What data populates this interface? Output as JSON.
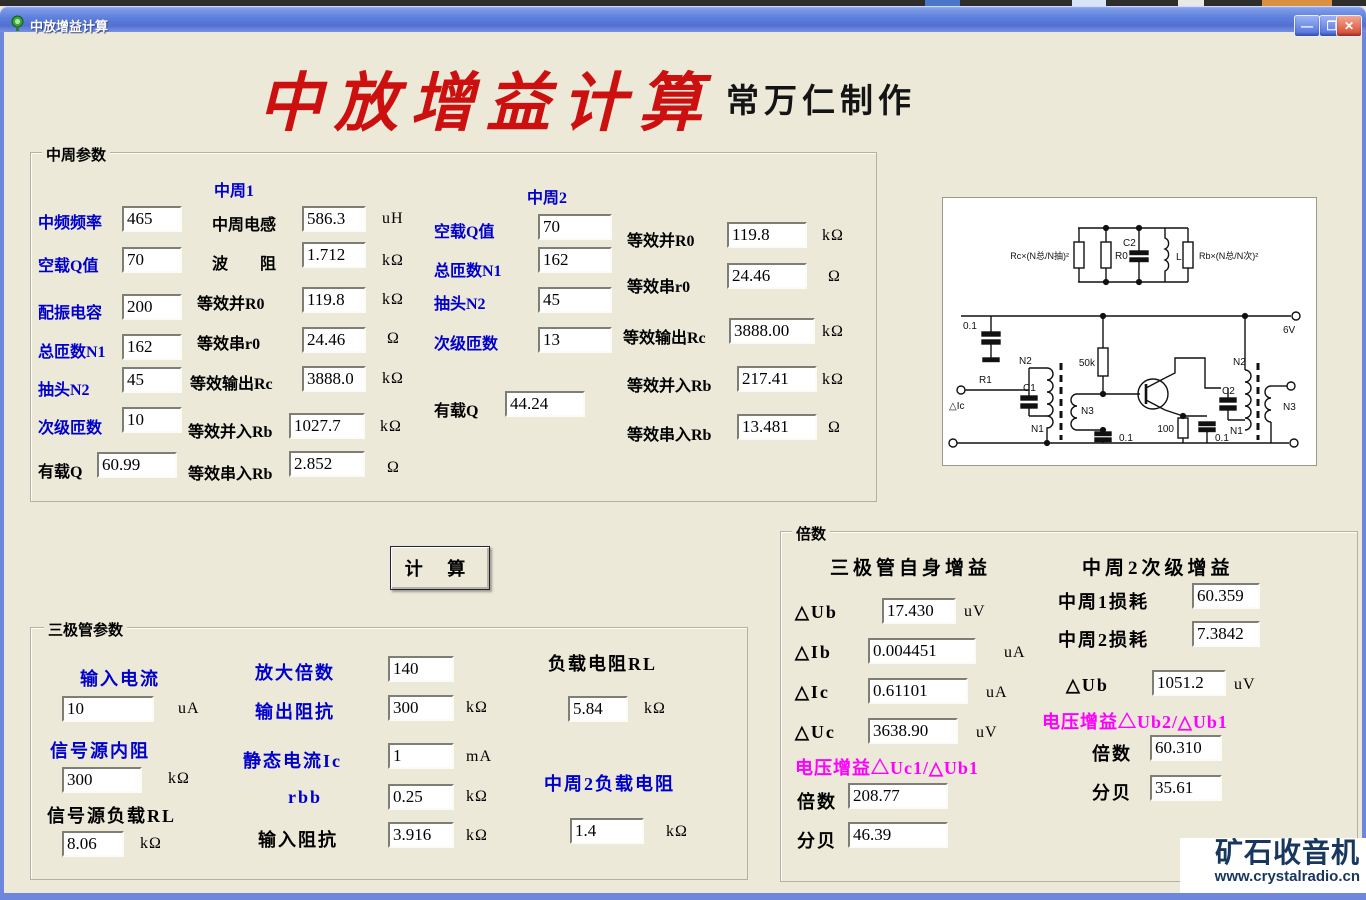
{
  "window": {
    "title": "中放增益计算",
    "min_glyph": "—",
    "max_glyph": "❐",
    "close_glyph": "✕"
  },
  "header": {
    "title": "中放增益计算",
    "author": "常万仁制作"
  },
  "ifp": {
    "group": "中周参数",
    "left": [
      {
        "label": "中频频率",
        "value": "465"
      },
      {
        "label": "空载Q值",
        "value": "70"
      },
      {
        "label": "配振电容",
        "value": "200"
      },
      {
        "label": "总匝数N1",
        "value": "162"
      },
      {
        "label": "抽头N2",
        "value": "45"
      },
      {
        "label": "次级匝数",
        "value": "10"
      },
      {
        "label": "有载Q",
        "value": "60.99"
      }
    ],
    "z1": {
      "header": "中周1",
      "rows": [
        {
          "label": "中周电感",
          "value": "586.3",
          "unit": "uH"
        },
        {
          "label": "波　　阻",
          "value": "1.712",
          "unit": "kΩ"
        },
        {
          "label": "等效并R0",
          "value": "119.8",
          "unit": "kΩ"
        },
        {
          "label": "等效串r0",
          "value": "24.46",
          "unit": "Ω"
        },
        {
          "label": "等效输出Rc",
          "value": "3888.0",
          "unit": "kΩ"
        },
        {
          "label": "等效并入Rb",
          "value": "1027.7",
          "unit": "kΩ"
        },
        {
          "label": "等效串入Rb",
          "value": "2.852",
          "unit": "Ω"
        }
      ]
    },
    "z2": {
      "header": "中周2",
      "rows": [
        {
          "label": "空载Q值",
          "value": "70"
        },
        {
          "label": "总匝数N1",
          "value": "162"
        },
        {
          "label": "抽头N2",
          "value": "45"
        },
        {
          "label": "次级匝数",
          "value": "13"
        },
        {
          "label": "有载Q",
          "value": "44.24"
        }
      ]
    },
    "right": [
      {
        "label": "等效并R0",
        "value": "119.8",
        "unit": "kΩ"
      },
      {
        "label": "等效串r0",
        "value": "24.46",
        "unit": "Ω"
      },
      {
        "label": "等效输出Rc",
        "value": "3888.00",
        "unit": "kΩ"
      },
      {
        "label": "等效并入Rb",
        "value": "217.41",
        "unit": "kΩ"
      },
      {
        "label": "等效串入Rb",
        "value": "13.481",
        "unit": "Ω"
      }
    ]
  },
  "calc": {
    "label": "计 算"
  },
  "tr": {
    "group": "三极管参数",
    "rows": [
      {
        "label": "输入电流",
        "value": "10",
        "unit": "uA"
      },
      {
        "label": "信号源内阻",
        "value": "300",
        "unit": "kΩ"
      },
      {
        "label": "信号源负载RL",
        "value": "8.06",
        "unit": "kΩ"
      },
      {
        "label": "放大倍数",
        "value": "140",
        "unit": ""
      },
      {
        "label": "输出阻抗",
        "value": "300",
        "unit": "kΩ"
      },
      {
        "label": "静态电流Ic",
        "value": "1",
        "unit": "mA"
      },
      {
        "label": "rbb",
        "value": "0.25",
        "unit": "kΩ"
      },
      {
        "label": "输入阻抗",
        "value": "3.916",
        "unit": "kΩ"
      },
      {
        "label": "负载电阻RL",
        "value": "5.84",
        "unit": "kΩ"
      },
      {
        "label": "中周2负载电阻",
        "value": "1.4",
        "unit": "kΩ"
      }
    ]
  },
  "gain": {
    "group": "倍数",
    "left": {
      "header": "三极管自身增益",
      "rows": [
        {
          "label": "△Ub",
          "value": "17.430",
          "unit": "uV"
        },
        {
          "label": "△Ib",
          "value": "0.004451",
          "unit": "uA"
        },
        {
          "label": "△Ic",
          "value": "0.61101",
          "unit": "uA"
        },
        {
          "label": "△Uc",
          "value": "3638.90",
          "unit": "uV"
        }
      ],
      "formula": "电压增益△Uc1/△Ub1",
      "ratio_label": "倍数",
      "ratio": "208.77",
      "db_label": "分贝",
      "db": "46.39"
    },
    "right": {
      "header": "中周2次级增益",
      "loss1_label": "中周1损耗",
      "loss1": "60.359",
      "loss2_label": "中周2损耗",
      "loss2": "7.3842",
      "dub_label": "△Ub",
      "dub": "1051.2",
      "dub_unit": "uV",
      "formula": "电压增益△Ub2/△Ub1",
      "ratio_label": "倍数",
      "ratio": "60.310",
      "db_label": "分贝",
      "db": "35.61"
    }
  },
  "circuit": {
    "rc": "Rc×(N总/N抽)²",
    "r0": "R0",
    "c2": "C2",
    "l": "L",
    "rb": "Rb×(N总/N次)²",
    "cap01a": "0.1",
    "r1": "R1",
    "dic": "△Ic",
    "n2a": "N2",
    "c1a": "C1",
    "n1a": "N1",
    "n3a": "N3",
    "r50k": "50k",
    "cap01b": "0.1",
    "r100": "100",
    "cap01c": "0.1",
    "n2b": "N2",
    "c2b": "C2",
    "n1b": "N1",
    "n3b": "N3",
    "v6": "6V"
  },
  "watermark": {
    "title": "矿石收音机",
    "url": "www.crystalradio.cn"
  },
  "colors": {
    "label_blue": "#0000cc",
    "magenta": "#ff00ff",
    "title_red": "#cc0f0f",
    "watermark_navy": "#17375e"
  }
}
